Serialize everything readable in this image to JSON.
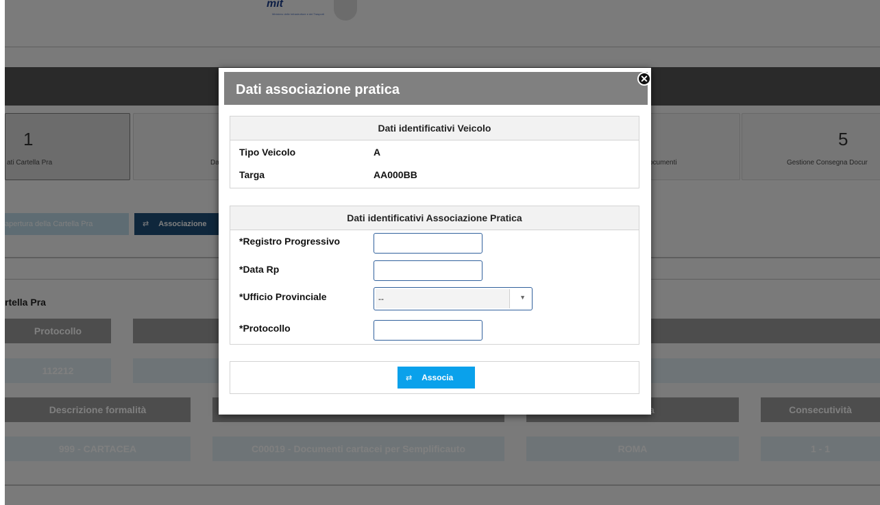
{
  "header": {
    "logo_text": "mit",
    "logo_subtitle": "Ministero delle Infrastrutture e dei Trasporti"
  },
  "steps": [
    {
      "number": "1",
      "label": "ati Cartella Pra"
    },
    {
      "label": "Da"
    },
    {
      "label": "ocumenti"
    },
    {
      "number": "5",
      "label": "Gestione Consegna Docur"
    }
  ],
  "actions": {
    "apertura_label": "apertura della Cartella Pra",
    "associazione_label": "Associazione"
  },
  "section": {
    "title": "rtella Pra"
  },
  "table1": {
    "headers": [
      "Protocollo"
    ],
    "row": [
      "112212"
    ]
  },
  "table2": {
    "headers": [
      "Descrizione formalità",
      "",
      "za",
      "Consecutività"
    ],
    "row": [
      "999 - CARTACEA",
      "C00019 - Documenti cartacei per Semplificauto",
      "ROMA",
      "1 - 1"
    ]
  },
  "dialog": {
    "title": "Dati associazione pratica",
    "veicolo_panel": {
      "header": "Dati identificativi Veicolo",
      "tipo_label": "Tipo Veicolo",
      "tipo_value": "A",
      "targa_label": "Targa",
      "targa_value": "AA000BB"
    },
    "pratica_panel": {
      "header": "Dati identificativi Associazione Pratica",
      "registro_label": "*Registro Progressivo",
      "registro_value": "",
      "data_label": "*Data Rp",
      "data_value": "",
      "ufficio_label": "*Ufficio Provinciale",
      "ufficio_value": "--",
      "protocollo_label": "*Protocollo",
      "protocollo_value": ""
    },
    "submit_label": "Associa",
    "colors": {
      "submit": "#0aa1eb",
      "header": "#808080"
    }
  },
  "icons": {
    "close": "close-icon",
    "link": "link-icon",
    "dropdown": "chevron-down-icon"
  }
}
